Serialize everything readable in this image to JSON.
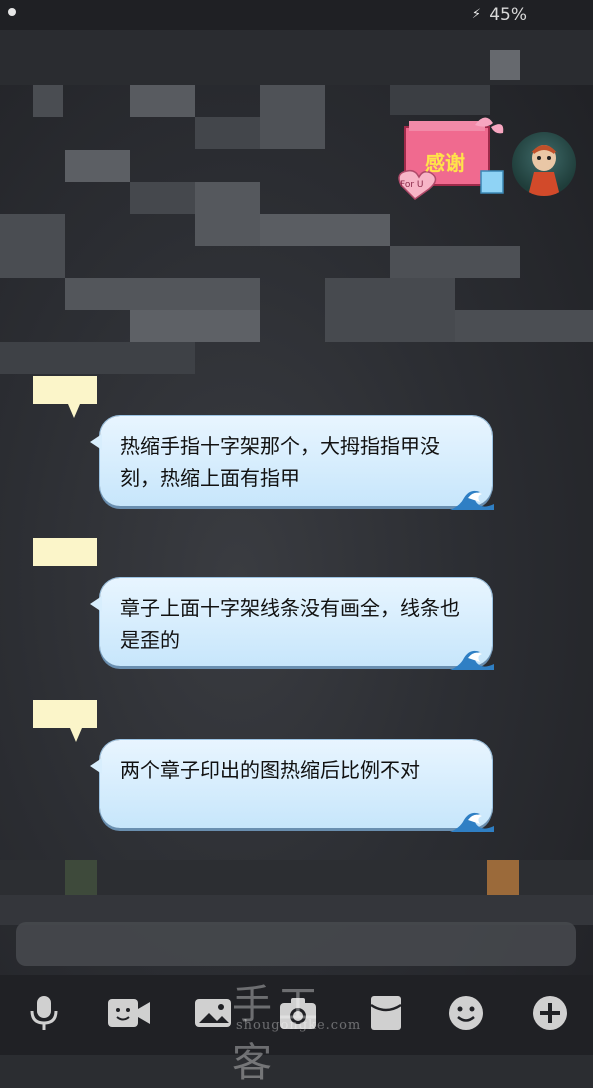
{
  "status_bar": {
    "battery": "45%",
    "charging_icon": "charging-bolt-icon"
  },
  "sticker": {
    "main_text": "感谢",
    "heart_text": "For U"
  },
  "messages": [
    {
      "text": "热缩手指十字架那个，大拇指指甲没刻，热缩上面有指甲"
    },
    {
      "text": "章子上面十字架线条没有画全，线条也是歪的"
    },
    {
      "text": "两个章子印出的图热缩后比例不对"
    }
  ],
  "toolbar": {
    "items": [
      "microphone-icon",
      "video-call-icon",
      "image-icon",
      "camera-icon",
      "red-packet-icon",
      "emoji-icon",
      "plus-icon"
    ]
  },
  "watermark": {
    "cn": "手工客",
    "en": "shougongke.com"
  }
}
